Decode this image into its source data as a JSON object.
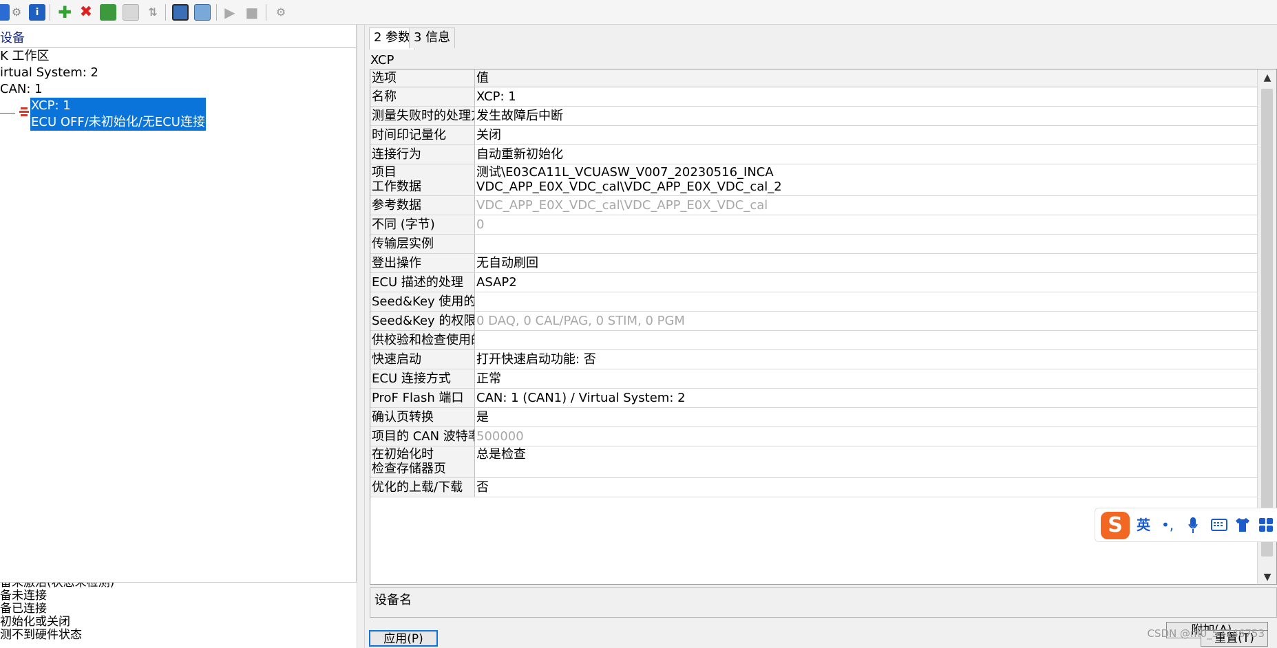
{
  "toolbar": {
    "icons": [
      "blank-icon",
      "network-icon",
      "info-icon",
      "add-icon",
      "delete-icon",
      "module-icon",
      "disabled-module-icon",
      "sort-icon",
      "workspace-icon",
      "hardware-icon",
      "play-icon",
      "stop-icon",
      "config-icon"
    ]
  },
  "left": {
    "header": "设备",
    "tree": [
      "K 工作区",
      "irtual System: 2",
      " CAN: 1"
    ],
    "selected": {
      "line1": "XCP: 1",
      "line2": "ECU OFF/未初始化/无ECU连接"
    },
    "legend": [
      "备未激活(状态未检测)",
      "备未连接",
      "备已连接",
      "初始化或关闭",
      "测不到硬件状态"
    ]
  },
  "tabs": [
    "2 参数",
    "3 信息"
  ],
  "section_title": "XCP",
  "grid": {
    "header": [
      "选项",
      "值"
    ],
    "rows": [
      {
        "option": "名称",
        "value": "XCP: 1"
      },
      {
        "option": "测量失败时的处理方",
        "value": "发生故障后中断"
      },
      {
        "option": "时间印记量化",
        "value": "关闭"
      },
      {
        "option": "连接行为",
        "value": "自动重新初始化"
      },
      {
        "option": "项目",
        "option2": "工作数据",
        "value": "测试\\E03CA11L_VCUASW_V007_20230516_INCA",
        "value2": "VDC_APP_E0X_VDC_cal\\VDC_APP_E0X_VDC_cal_2"
      },
      {
        "option": "参考数据",
        "value": "VDC_APP_E0X_VDC_cal\\VDC_APP_E0X_VDC_cal"
      },
      {
        "option": "不同 (字节)",
        "value": "0"
      },
      {
        "option": "传输层实例",
        "value": ""
      },
      {
        "option": "登出操作",
        "value": "无自动刷回"
      },
      {
        "option": "ECU 描述的处理",
        "value": "ASAP2"
      },
      {
        "option": "Seed&Key 使用的",
        "value": ""
      },
      {
        "option": "Seed&Key 的权限",
        "value": "0 DAQ, 0 CAL/PAG, 0 STIM, 0 PGM"
      },
      {
        "option": "供校验和检查使用的",
        "value": ""
      },
      {
        "option": "快速启动",
        "value": "打开快速启动功能: 否"
      },
      {
        "option": "ECU 连接方式",
        "value": "正常"
      },
      {
        "option": "ProF Flash 端口",
        "value": "CAN: 1 (CAN1) / Virtual System: 2"
      },
      {
        "option": "确认页转换",
        "value": "是"
      },
      {
        "option": "项目的 CAN 波特率",
        "value": "500000"
      },
      {
        "option": "在初始化时",
        "option2": "检查存储器页",
        "value": "总是检查",
        "value2": ""
      },
      {
        "option": "优化的上载/下载",
        "value": "否"
      }
    ]
  },
  "description": {
    "label": "设备名"
  },
  "buttons": {
    "attach": "附加(A)...",
    "apply": "应用(P)",
    "reset": "重置(T)"
  },
  "ime": {
    "logo": "S",
    "lang": "英",
    "punct": "•,"
  },
  "watermark": "CSDN @m0_57746753",
  "colors": {
    "selection": "#0a74da",
    "header_blue": "#1a2b8c",
    "ime_orange": "#f26722",
    "dim_text": "#a8a8a8"
  }
}
